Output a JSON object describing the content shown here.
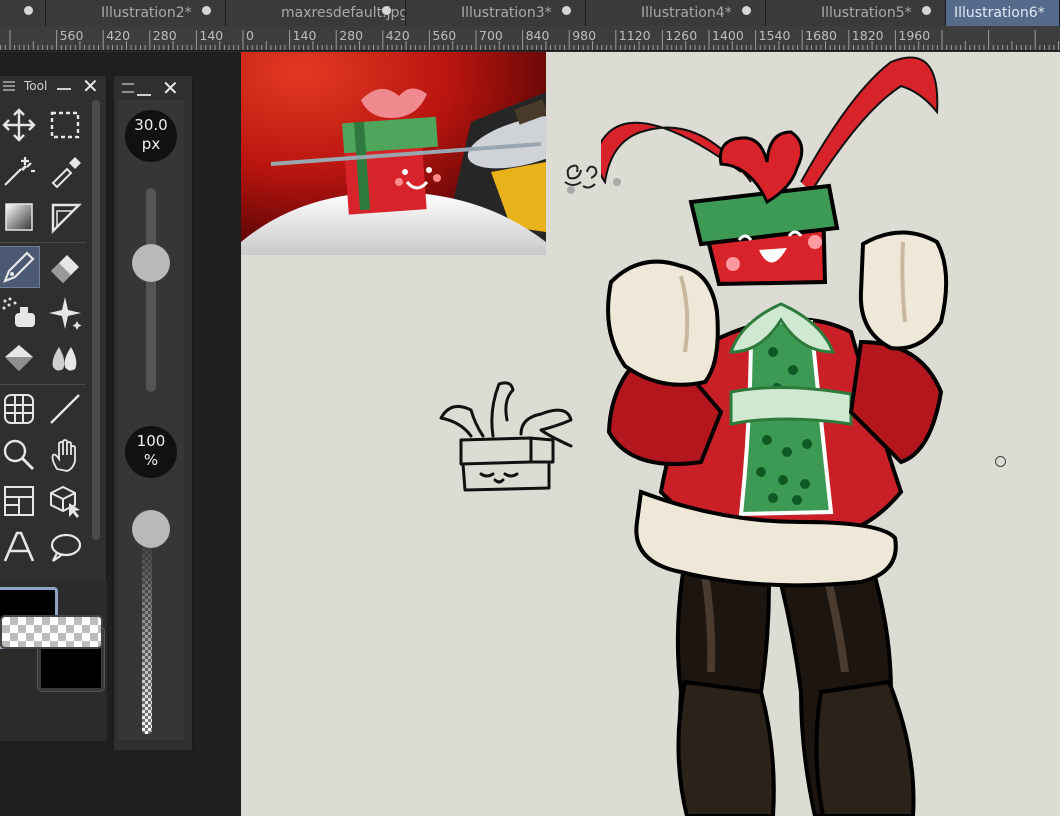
{
  "tabs": [
    {
      "label": "",
      "active": false
    },
    {
      "label": "Illustration2*",
      "active": false
    },
    {
      "label": "maxresdefault.jpg*",
      "active": false
    },
    {
      "label": "Illustration3*",
      "active": false
    },
    {
      "label": "Illustration4*",
      "active": false
    },
    {
      "label": "Illustration5*",
      "active": false
    },
    {
      "label": "Illustration6*",
      "active": true
    }
  ],
  "ruler": {
    "labels": [
      "560",
      "420",
      "280",
      "140",
      "0",
      "140",
      "280",
      "420",
      "560",
      "700",
      "840",
      "980",
      "1120",
      "1260",
      "1400",
      "1540",
      "1680",
      "1820",
      "1960"
    ]
  },
  "tool_panel": {
    "title": "Tool",
    "tools": [
      {
        "name": "move-icon",
        "selected": false
      },
      {
        "name": "selection-icon",
        "selected": false
      },
      {
        "name": "auto-select-icon",
        "selected": false
      },
      {
        "name": "eyedropper-icon",
        "selected": false
      },
      {
        "name": "gradient-icon",
        "selected": false
      },
      {
        "name": "ruler-icon",
        "selected": false
      },
      {
        "name": "pen-icon",
        "selected": true
      },
      {
        "name": "eraser-icon",
        "selected": false
      },
      {
        "name": "airbrush-icon",
        "selected": false
      },
      {
        "name": "decoration-icon",
        "selected": false
      },
      {
        "name": "fill-icon",
        "selected": false
      },
      {
        "name": "blend-icon",
        "selected": false
      },
      {
        "name": "mesh-icon",
        "selected": false
      },
      {
        "name": "line-icon",
        "selected": false
      },
      {
        "name": "zoom-icon",
        "selected": false
      },
      {
        "name": "hand-icon",
        "selected": false
      },
      {
        "name": "frame-icon",
        "selected": false
      },
      {
        "name": "object-icon",
        "selected": false
      },
      {
        "name": "text-icon",
        "selected": false
      },
      {
        "name": "balloon-icon",
        "selected": false
      }
    ]
  },
  "brush_panel": {
    "size_value": "30.0",
    "size_unit": "px",
    "opacity_value": "100",
    "opacity_unit": "%",
    "size_level": 0.32,
    "opacity_level": 1.0
  },
  "colors": {
    "main": "#000000",
    "sub": "#000000",
    "active_tab": "#566a8c",
    "canvas": "#dcdbd4"
  }
}
